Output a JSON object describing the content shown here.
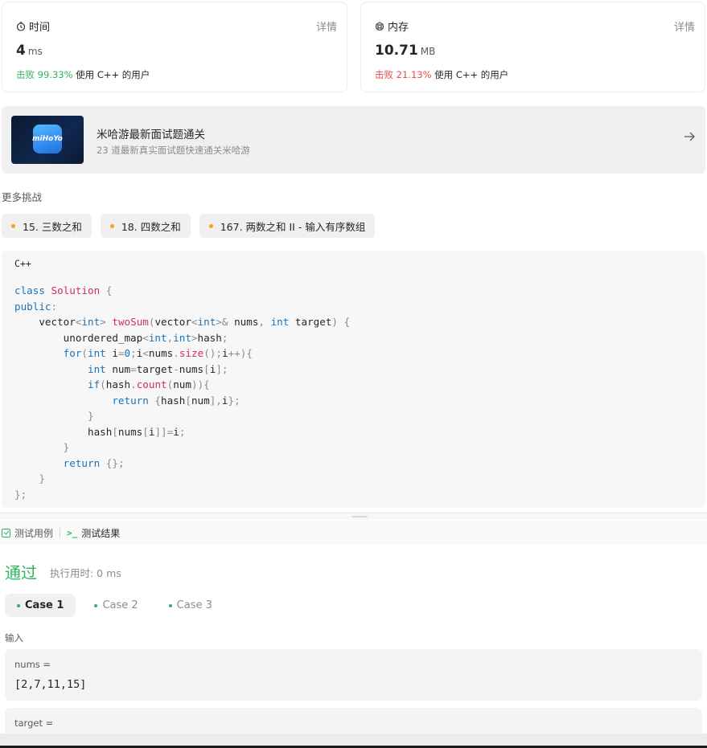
{
  "stats": {
    "runtime": {
      "title": "时间",
      "detail": "详情",
      "value": "4",
      "unit": "ms",
      "beat_prefix": "击败 ",
      "beat_pct": "99.33%",
      "beat_suffix": " 使用 C++ 的用户"
    },
    "memory": {
      "title": "内存",
      "detail": "详情",
      "value": "10.71",
      "unit": "MB",
      "beat_prefix": "击败 ",
      "beat_pct": "21.13%",
      "beat_suffix": " 使用 C++ 的用户"
    }
  },
  "promo": {
    "logo_text": "miHoYo",
    "title": "米哈游最新面试题通关",
    "subtitle": "23 道最新真实面试题快速通关米哈游"
  },
  "more_challenges": {
    "label": "更多挑战",
    "items": [
      "15. 三数之和",
      "18. 四数之和",
      "167. 两数之和 II - 输入有序数组"
    ]
  },
  "code": {
    "language": "C++",
    "lines": [
      "class Solution {",
      "public:",
      "    vector<int> twoSum(vector<int>& nums, int target) {",
      "        unordered_map<int,int>hash;",
      "        for(int i=0;i<nums.size();i++){",
      "            int num=target-nums[i];",
      "            if(hash.count(num)){",
      "                return {hash[num],i};",
      "            }",
      "            hash[nums[i]]=i;",
      "        }",
      "        return {};",
      "    }",
      "};"
    ]
  },
  "tabs": {
    "test_cases": "测试用例",
    "test_result": "测试结果"
  },
  "result": {
    "status": "通过",
    "runtime_label": "执行用时: 0 ms",
    "cases": [
      "Case 1",
      "Case 2",
      "Case 3"
    ],
    "active_case": 0,
    "input_label": "输入",
    "inputs": [
      {
        "name": "nums =",
        "value": "[2,7,11,15]"
      },
      {
        "name": "target =",
        "value": ""
      }
    ]
  },
  "colors": {
    "accent_green": "#2db55d",
    "accent_red": "#ef4743",
    "accent_orange": "#ffa116"
  }
}
